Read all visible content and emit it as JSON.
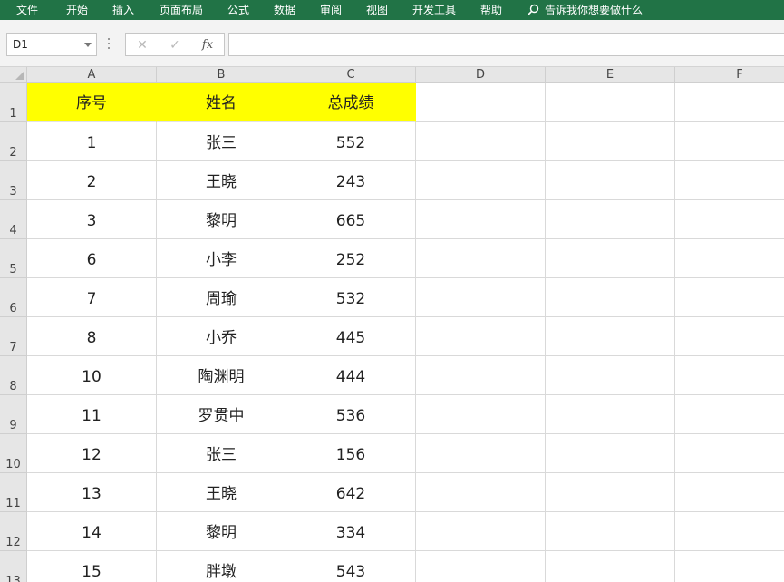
{
  "ribbon": {
    "tabs": [
      "文件",
      "开始",
      "插入",
      "页面布局",
      "公式",
      "数据",
      "审阅",
      "视图",
      "开发工具",
      "帮助"
    ],
    "tell_me": "告诉我你想要做什么",
    "bar_color": "#217346"
  },
  "formula_bar": {
    "name_box": "D1",
    "cancel_glyph": "✕",
    "enter_glyph": "✓",
    "fx_label": "fx",
    "formula": ""
  },
  "grid": {
    "columns": [
      "A",
      "B",
      "C",
      "D",
      "E",
      "F"
    ],
    "row_numbers": [
      "1",
      "2",
      "3",
      "4",
      "5",
      "6",
      "7",
      "8",
      "9",
      "10",
      "11",
      "12",
      "13"
    ],
    "header_fill": "#ffff00",
    "header_row": [
      "序号",
      "姓名",
      "总成绩"
    ],
    "rows": [
      [
        "1",
        "张三",
        "552"
      ],
      [
        "2",
        "王晓",
        "243"
      ],
      [
        "3",
        "黎明",
        "665"
      ],
      [
        "6",
        "小李",
        "252"
      ],
      [
        "7",
        "周瑜",
        "532"
      ],
      [
        "8",
        "小乔",
        "445"
      ],
      [
        "10",
        "陶渊明",
        "444"
      ],
      [
        "11",
        "罗贯中",
        "536"
      ],
      [
        "12",
        "张三",
        "156"
      ],
      [
        "13",
        "王晓",
        "642"
      ],
      [
        "14",
        "黎明",
        "334"
      ],
      [
        "15",
        "胖墩",
        "543"
      ]
    ]
  }
}
